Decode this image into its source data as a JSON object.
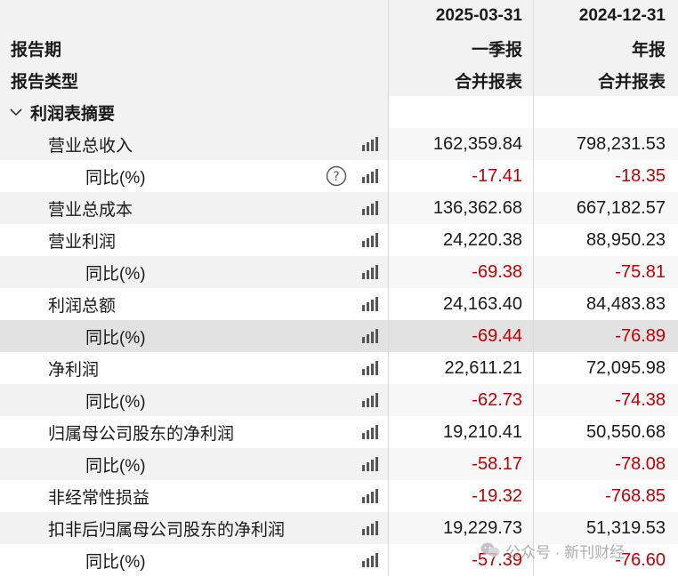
{
  "header": {
    "period_label": "报告期",
    "type_label": "报告类型",
    "columns": [
      {
        "date": "2025-03-31",
        "period": "一季报",
        "type": "合并报表"
      },
      {
        "date": "2024-12-31",
        "period": "年报",
        "type": "合并报表"
      }
    ]
  },
  "section": {
    "title": "利润表摘要"
  },
  "rows": [
    {
      "label": "营业总收入",
      "level": 1,
      "v1": "162,359.84",
      "v2": "798,231.53"
    },
    {
      "label": "同比(%)",
      "level": 2,
      "v1": "-17.41",
      "v2": "-18.35",
      "help": true
    },
    {
      "label": "营业总成本",
      "level": 1,
      "v1": "136,362.68",
      "v2": "667,182.57"
    },
    {
      "label": "营业利润",
      "level": 1,
      "v1": "24,220.38",
      "v2": "88,950.23"
    },
    {
      "label": "同比(%)",
      "level": 2,
      "v1": "-69.38",
      "v2": "-75.81"
    },
    {
      "label": "利润总额",
      "level": 1,
      "v1": "24,163.40",
      "v2": "84,483.83"
    },
    {
      "label": "同比(%)",
      "level": 2,
      "v1": "-69.44",
      "v2": "-76.89",
      "highlight": true
    },
    {
      "label": "净利润",
      "level": 1,
      "v1": "22,611.21",
      "v2": "72,095.98"
    },
    {
      "label": "同比(%)",
      "level": 2,
      "v1": "-62.73",
      "v2": "-74.38"
    },
    {
      "label": "归属母公司股东的净利润",
      "level": 1,
      "v1": "19,210.41",
      "v2": "50,550.68"
    },
    {
      "label": "同比(%)",
      "level": 2,
      "v1": "-58.17",
      "v2": "-78.08"
    },
    {
      "label": "非经常性损益",
      "level": 1,
      "v1": "-19.32",
      "v2": "-768.85"
    },
    {
      "label": "扣非后归属母公司股东的净利润",
      "level": 1,
      "v1": "19,229.73",
      "v2": "51,319.53"
    },
    {
      "label": "同比(%)",
      "level": 2,
      "v1": "-57.39",
      "v2": "-76.60"
    }
  ],
  "watermark": {
    "text": "公众号 · 新刊财经"
  },
  "colors": {
    "negative": "#c00000",
    "stripe": "#f2f2f2",
    "highlight": "#e2e2e2"
  }
}
